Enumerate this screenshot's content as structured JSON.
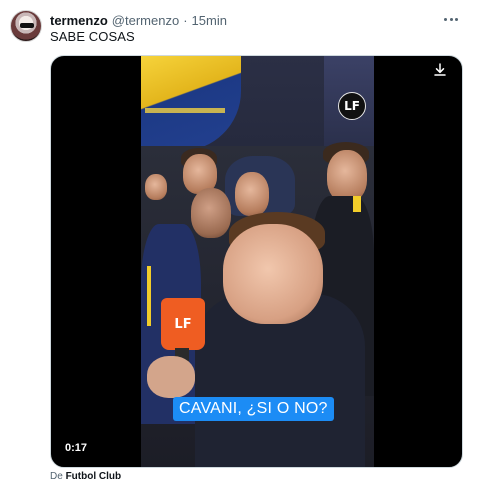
{
  "tweet": {
    "display_name": "termenzo",
    "handle": "@termenzo",
    "separator": "·",
    "timestamp": "15min",
    "text": "SABE COSAS"
  },
  "media": {
    "caption": "CAVANI, ¿SI O NO?",
    "duration": "0:17",
    "watermark": "LF",
    "mic_logo": "LF",
    "icons": {
      "download": "download-icon",
      "more": "more-options-icon"
    }
  },
  "source": {
    "prefix": "De",
    "name": "Futbol Club"
  },
  "colors": {
    "caption_bg": "#1c8cf5",
    "mic": "#ef5d22",
    "text_primary": "#0f1419",
    "text_secondary": "#536471"
  }
}
